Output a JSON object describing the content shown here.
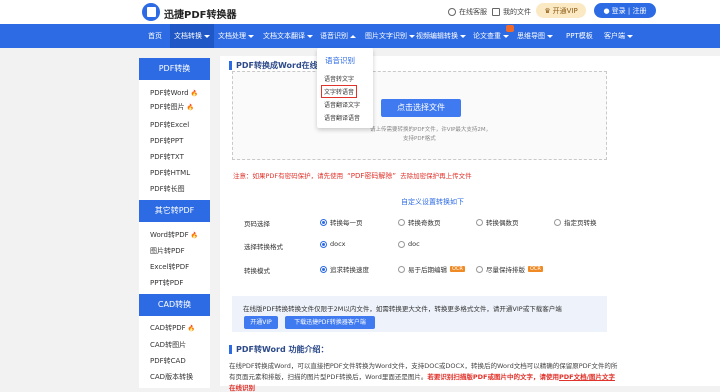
{
  "header": {
    "logo_text": "迅捷PDF转换器",
    "links": [
      "在线客服",
      "我的文件"
    ],
    "vip_label": "开通VIP",
    "login_label": "登录 | 注册"
  },
  "nav": {
    "items": [
      "首页",
      "文档转换",
      "文档处理",
      "文档文本翻译",
      "语音识别",
      "图片文字识别",
      "视频编辑转换",
      "论文查重",
      "思维导图",
      "PPT模板",
      "客户端"
    ]
  },
  "dropdown": {
    "title": "语音识别",
    "items": [
      "语音转文字",
      "文字转语音",
      "语音翻译文字",
      "语音翻译语音"
    ],
    "selected": "文字转语音"
  },
  "sidebar": {
    "sections": [
      {
        "title": "PDF转换",
        "items": [
          "PDF转Word",
          "PDF转图片",
          "PDF转Excel",
          "PDF转PPT",
          "PDF转TXT",
          "PDF转HTML",
          "PDF转长图"
        ]
      },
      {
        "title": "其它转PDF",
        "items": [
          "Word转PDF",
          "图片转PDF",
          "Excel转PDF",
          "PPT转PDF"
        ]
      },
      {
        "title": "CAD转换",
        "items": [
          "CAD转PDF",
          "CAD转图片",
          "PDF转CAD",
          "CAD版本转换"
        ]
      }
    ]
  },
  "main": {
    "title": "PDF转换成Word在线",
    "upload_label": "点击选择文件",
    "upload_hints": [
      "请上传需要转换的PDF文件，许VIP最大支持2M，",
      "支持PDF格式"
    ],
    "notice_prefix": "注意：如果PDF有密码保护，请先使用",
    "notice_link": "“PDF密码解除”",
    "notice_suffix": "去除加密保护再上传文件",
    "settings_title": "自定义设置转换如下",
    "page_select_label": "页码选择",
    "page_options": [
      "转换每一页",
      "转换奇数页",
      "转换偶数页",
      "指定页转换"
    ],
    "format_label": "选择转换格式",
    "format_options": [
      "docx",
      "doc"
    ],
    "mode_label": "转换模式",
    "mode_options": [
      "追求转换速度",
      "易于后期编辑",
      "尽量保持排版"
    ],
    "info_text": "在线版PDF转换转换文件仅限于2M以内文件，如需转换更大文件，转换更多格式文件，请开通VIP或下载客户端",
    "vip_button": "开通VIP",
    "download_button": "下载迅捷PDF转换器客户端",
    "intro_title": "PDF转Word 功能介绍：",
    "intro_line1": "在线PDF转换成Word，可以直接把PDF文件转换为Word文件，支持DOC或DOCX，转换后的Word文档可以精确的保留原PDF文件的所",
    "intro_line2_prefix": "有页面元素和排版，扫描的图片型PDF转换后，Word里面还是图片。",
    "intro_line2_highlight": "若要识别扫描版PDF或图片中的文字，请使用",
    "intro_line2_link": "PDF文档/图片文字",
    "intro_line3": "在线识别"
  },
  "colors": {
    "brand": "#2d6be4",
    "warning": "#e0332b",
    "tag": "#f08a24"
  }
}
